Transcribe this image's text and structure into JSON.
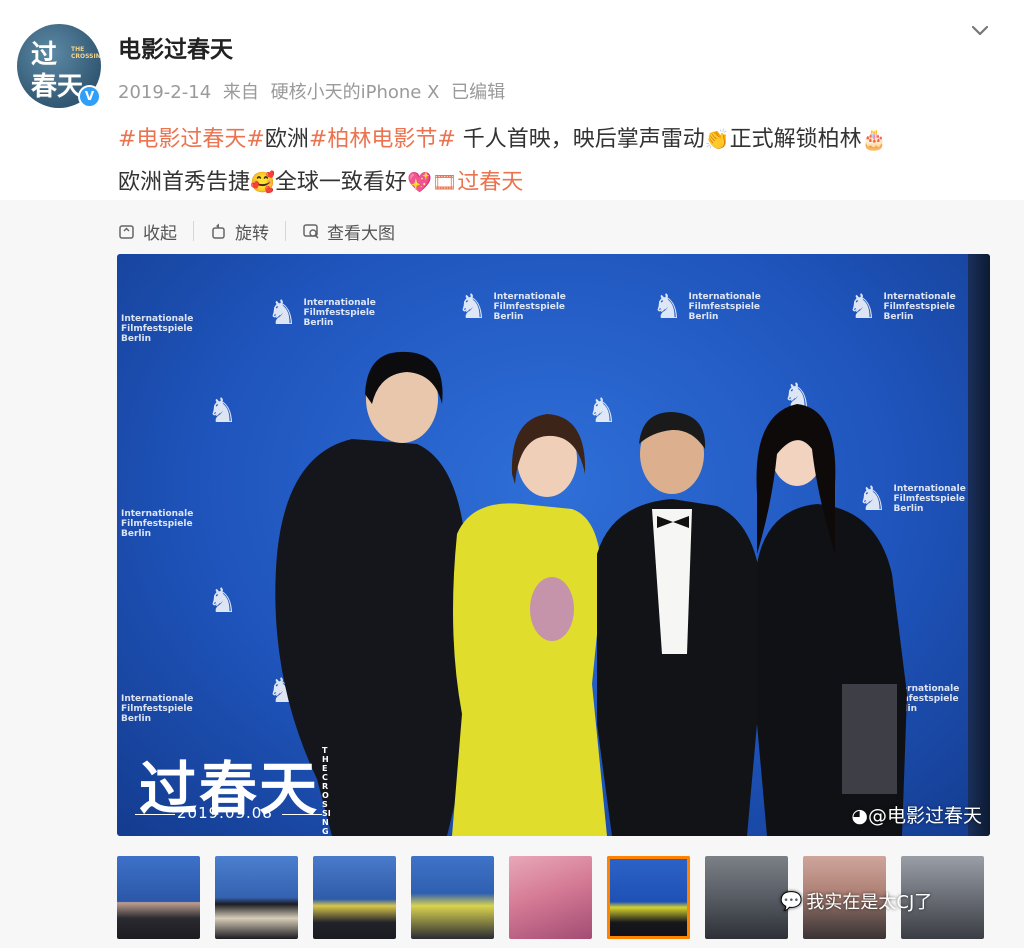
{
  "account": {
    "avatar": {
      "line1": "过",
      "line2": "春天",
      "small": "THE CROSSING"
    },
    "username": "电影过春天",
    "date": "2019-2-14",
    "source_prefix": "来自",
    "source": "硬核小天的iPhone X",
    "edited": "已编辑"
  },
  "post": {
    "tag1": "#电影过春天#",
    "text1": "欧洲",
    "tag2": "#柏林电影节#",
    "text2": " 千人首映，映后掌声雷动",
    "emoji_clap": "👏",
    "text3": "正式解锁柏林",
    "emoji_cake": "🎂",
    "text4": "欧洲首秀告捷",
    "emoji_happy": "🥰",
    "text5": "全球一致看好",
    "emoji_heart": "💖",
    "emoji_film": "🎞",
    "link": "过春天"
  },
  "toolbar": {
    "collapse": "收起",
    "rotate": "旋转",
    "view_large": "查看大图"
  },
  "photo": {
    "backdrop_logo": "Internationale Filmfestspiele Berlin",
    "stamp_title": "过春天",
    "stamp_sub": "THE CROSSING",
    "stamp_date": "2019.03.08",
    "watermark": "@电影过春天"
  },
  "thumbnail_watermark": "我实在是太CJ了",
  "colors": {
    "accent_link": "#eb7350",
    "verified": "#2f9ff8",
    "active_thumb": "#ff8200",
    "backdrop": "#1f55bd"
  }
}
